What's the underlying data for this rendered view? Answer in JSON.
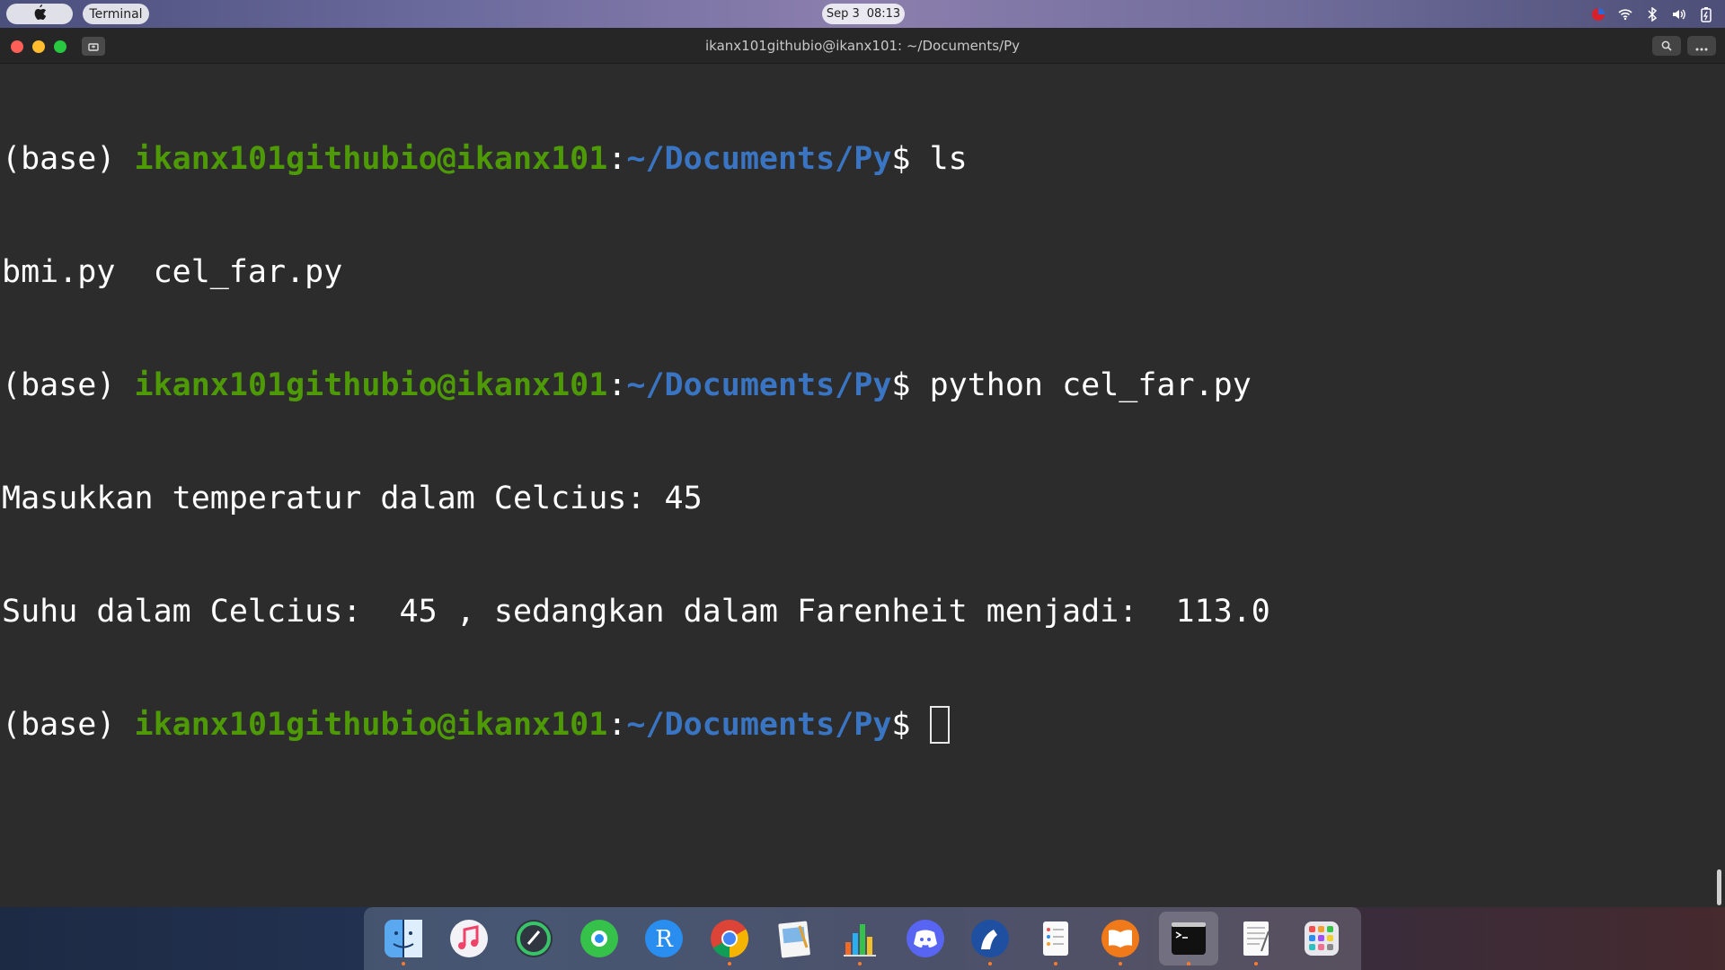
{
  "topbar": {
    "apple_icon": "apple-logo-icon",
    "app_name": "Terminal",
    "date": "Sep 3",
    "time": "08:13",
    "tray_icons": [
      "color-record-icon",
      "wifi-icon",
      "bluetooth-icon",
      "volume-icon",
      "battery-icon"
    ]
  },
  "window": {
    "title": "ikanx101githubio@ikanx101: ~/Documents/Py",
    "buttons": [
      "close",
      "minimize",
      "maximize",
      "new-tab-icon",
      "search-icon",
      "menu-icon"
    ]
  },
  "terminal": {
    "env": "(base) ",
    "user_host": "ikanx101githubio@ikanx101",
    "colon": ":",
    "path": "~/Documents/Py",
    "prompt_end": "$ ",
    "cmd1": "ls",
    "output1": "bmi.py  cel_far.py",
    "cmd2": "python cel_far.py",
    "output2": "Masukkan temperatur dalam Celcius: 45",
    "output3": "Suhu dalam Celcius:  45 , sedangkan dalam Farenheit menjadi:  113.0",
    "cmd3": ""
  },
  "dock": {
    "apps": [
      {
        "name": "finder-icon",
        "running": true
      },
      {
        "name": "music-icon",
        "running": false
      },
      {
        "name": "ccleaner-icon",
        "running": false
      },
      {
        "name": "find-my-icon",
        "running": false
      },
      {
        "name": "r-language-icon",
        "running": false
      },
      {
        "name": "chrome-icon",
        "running": true
      },
      {
        "name": "preview-icon",
        "running": false
      },
      {
        "name": "stats-chart-icon",
        "running": true
      },
      {
        "name": "discord-icon",
        "running": false
      },
      {
        "name": "fantastical-icon",
        "running": true
      },
      {
        "name": "reminders-icon",
        "running": true
      },
      {
        "name": "books-icon",
        "running": true
      },
      {
        "name": "terminal-icon",
        "running": true
      },
      {
        "name": "textedit-icon",
        "running": true
      },
      {
        "name": "launchpad-icon",
        "running": false
      }
    ]
  },
  "colors": {
    "user_host": "#4e9a06",
    "path": "#3a75c4",
    "terminal_bg": "#2c2c2c",
    "text": "#ffffff"
  }
}
